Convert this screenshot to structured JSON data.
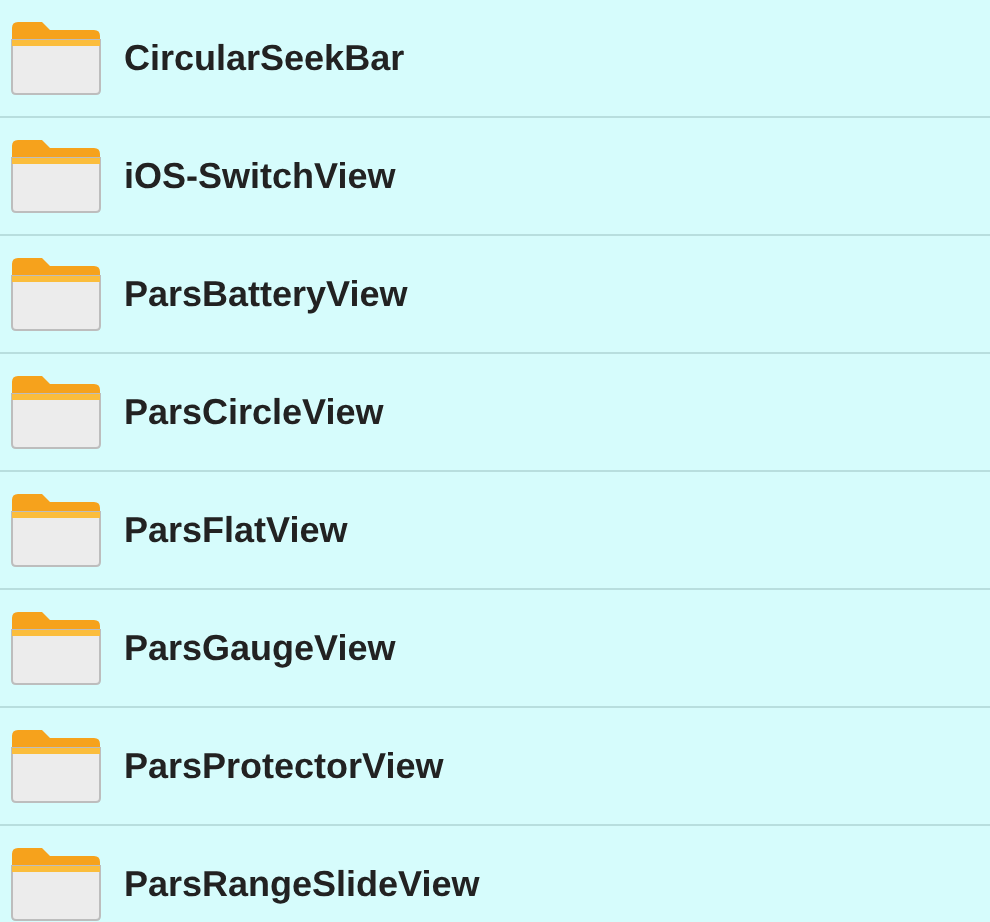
{
  "folders": [
    {
      "name": "CircularSeekBar"
    },
    {
      "name": "iOS-SwitchView"
    },
    {
      "name": "ParsBatteryView"
    },
    {
      "name": "ParsCircleView"
    },
    {
      "name": "ParsFlatView"
    },
    {
      "name": "ParsGaugeView"
    },
    {
      "name": "ParsProtectorView"
    },
    {
      "name": "ParsRangeSlideView"
    }
  ]
}
